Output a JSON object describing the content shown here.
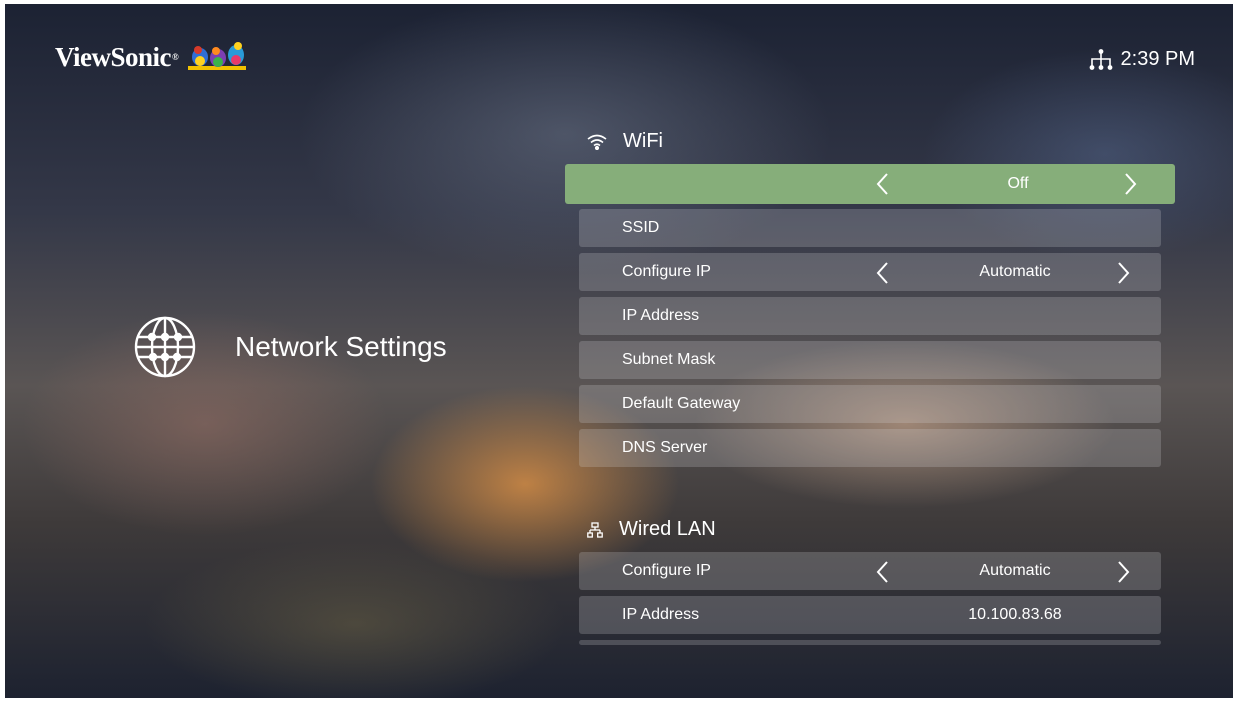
{
  "brand": {
    "name": "ViewSonic",
    "reg": "®"
  },
  "status": {
    "time": "2:39 PM",
    "network_icon": "network-tree-icon"
  },
  "page": {
    "title": "Network Settings",
    "icon": "globe-icon"
  },
  "wifi": {
    "heading": "WiFi",
    "icon": "wifi-icon",
    "toggle_value": "Off",
    "rows": [
      {
        "label": "SSID",
        "value": ""
      },
      {
        "label": "Configure IP",
        "value": "Automatic"
      },
      {
        "label": "IP Address",
        "value": ""
      },
      {
        "label": "Subnet Mask",
        "value": ""
      },
      {
        "label": "Default Gateway",
        "value": ""
      },
      {
        "label": "DNS Server",
        "value": ""
      }
    ]
  },
  "lan": {
    "heading": "Wired LAN",
    "icon": "lan-icon",
    "rows": [
      {
        "label": "Configure IP",
        "value": "Automatic"
      },
      {
        "label": "IP Address",
        "value": "10.100.83.68"
      }
    ]
  },
  "colors": {
    "highlight": "#86ae7a",
    "row_bg": "rgba(220,220,225,0.22)"
  }
}
